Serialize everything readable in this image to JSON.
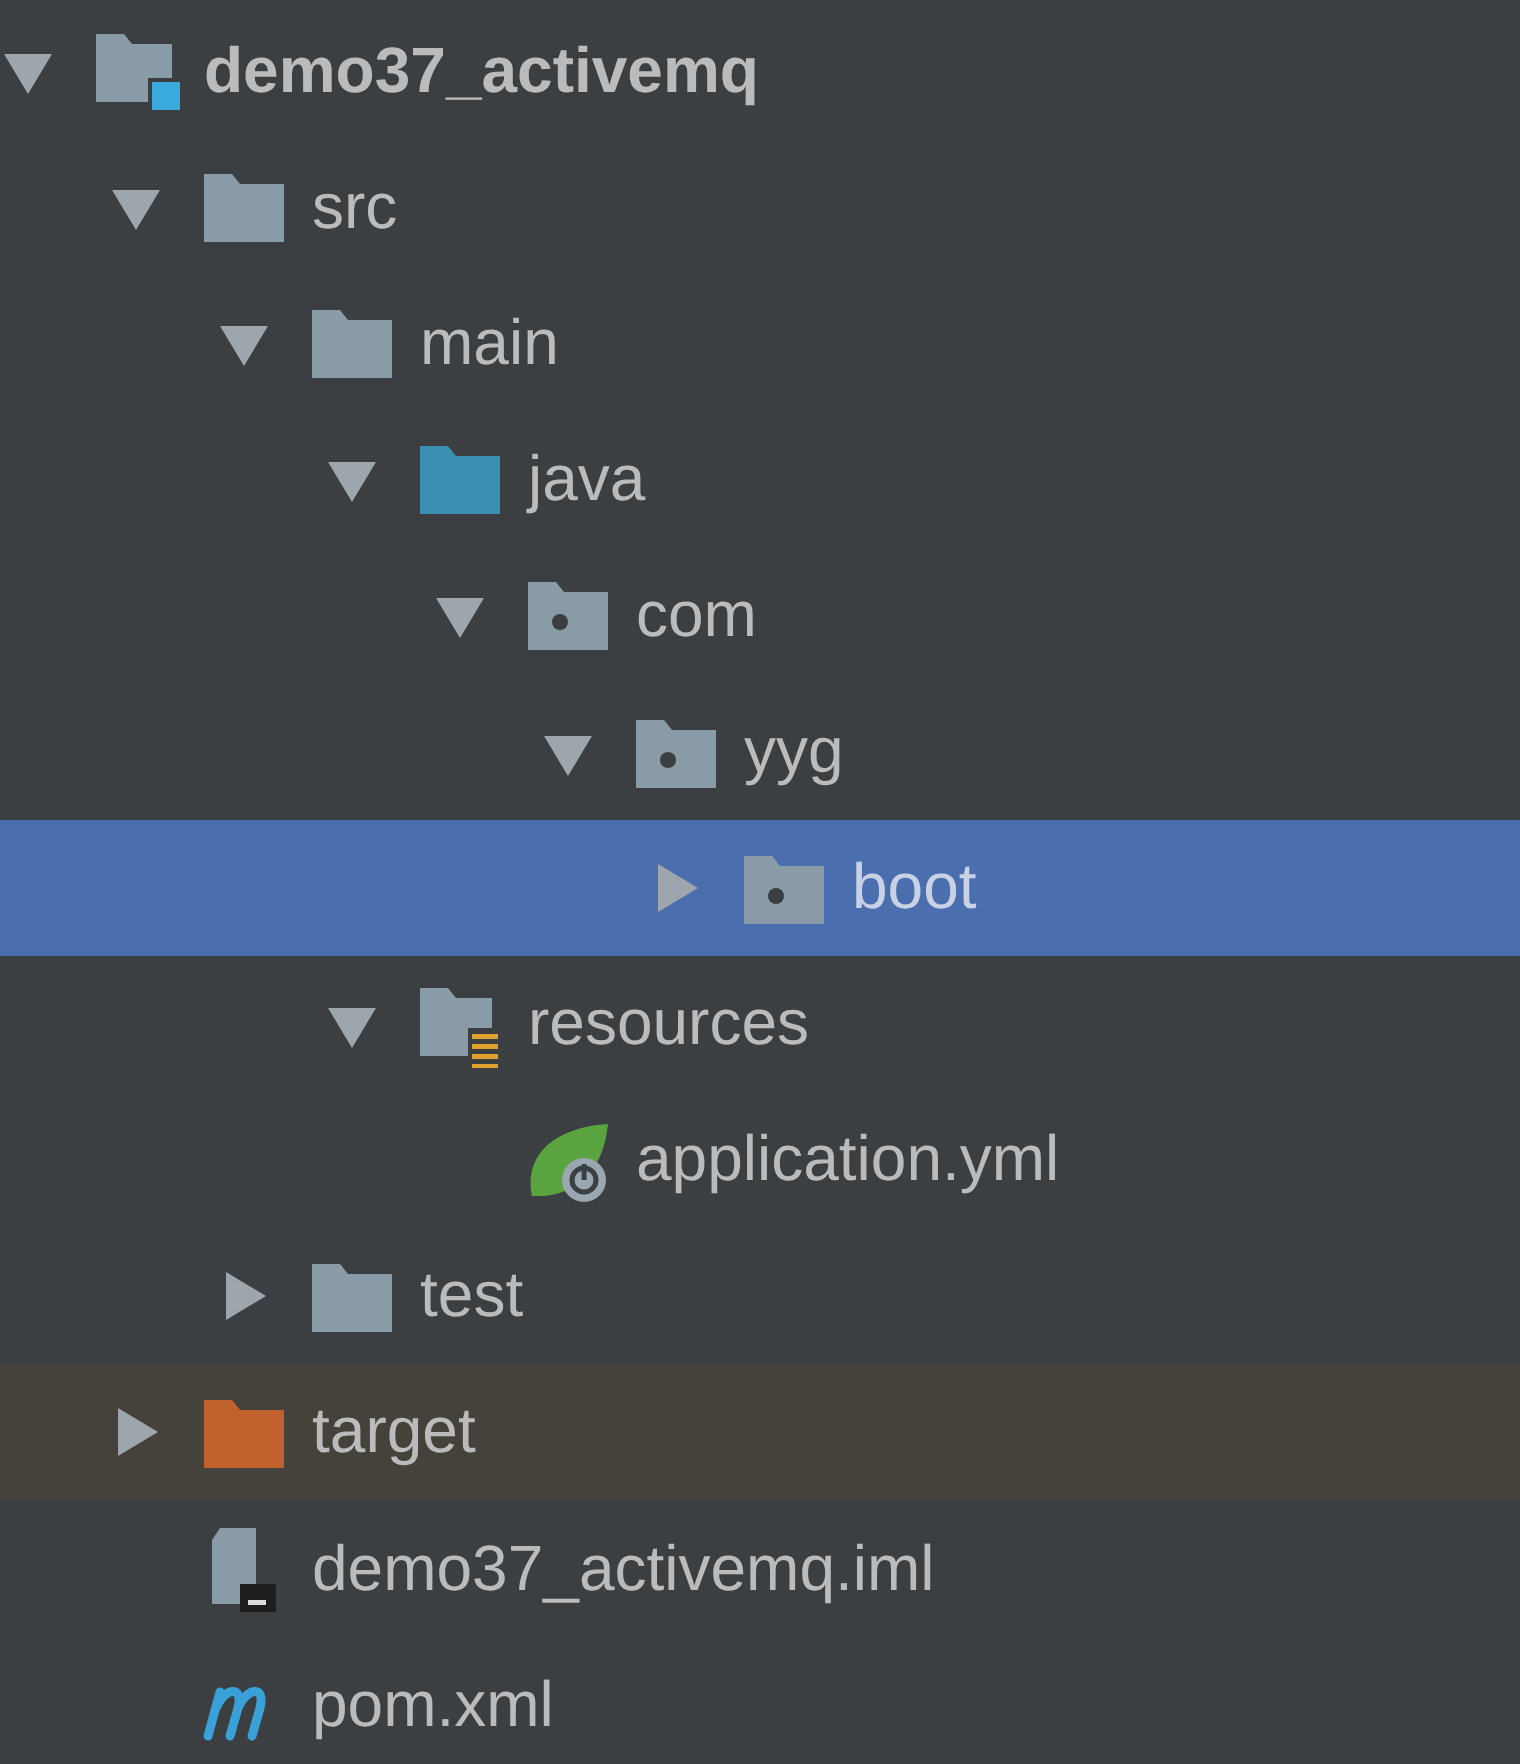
{
  "project_tree": [
    {
      "label": "demo37_activemq",
      "kind": "module",
      "bold": true,
      "expanded": true,
      "selected": false,
      "children": [
        {
          "label": "src",
          "kind": "folder",
          "bold": false,
          "expanded": true,
          "selected": false,
          "children": [
            {
              "label": "main",
              "kind": "folder",
              "bold": false,
              "expanded": true,
              "selected": false,
              "children": [
                {
                  "label": "java",
                  "kind": "source",
                  "bold": false,
                  "expanded": true,
                  "selected": false,
                  "children": [
                    {
                      "label": "com",
                      "kind": "package",
                      "bold": false,
                      "expanded": true,
                      "selected": false,
                      "children": [
                        {
                          "label": "yyg",
                          "kind": "package",
                          "bold": false,
                          "expanded": true,
                          "selected": false,
                          "children": [
                            {
                              "label": "boot",
                              "kind": "package",
                              "bold": false,
                              "expanded": false,
                              "selected": true
                            }
                          ]
                        }
                      ]
                    }
                  ]
                },
                {
                  "label": "resources",
                  "kind": "resources",
                  "bold": false,
                  "expanded": true,
                  "selected": false,
                  "children": [
                    {
                      "label": "application.yml",
                      "kind": "yml",
                      "bold": false,
                      "selected": false
                    }
                  ]
                }
              ]
            },
            {
              "label": "test",
              "kind": "folder",
              "bold": false,
              "expanded": false,
              "selected": false
            }
          ]
        },
        {
          "label": "target",
          "kind": "excluded",
          "bold": false,
          "expanded": false,
          "selected": false
        },
        {
          "label": "demo37_activemq.iml",
          "kind": "iml",
          "bold": false,
          "selected": false
        },
        {
          "label": "pom.xml",
          "kind": "maven",
          "bold": false,
          "selected": false
        }
      ]
    }
  ]
}
